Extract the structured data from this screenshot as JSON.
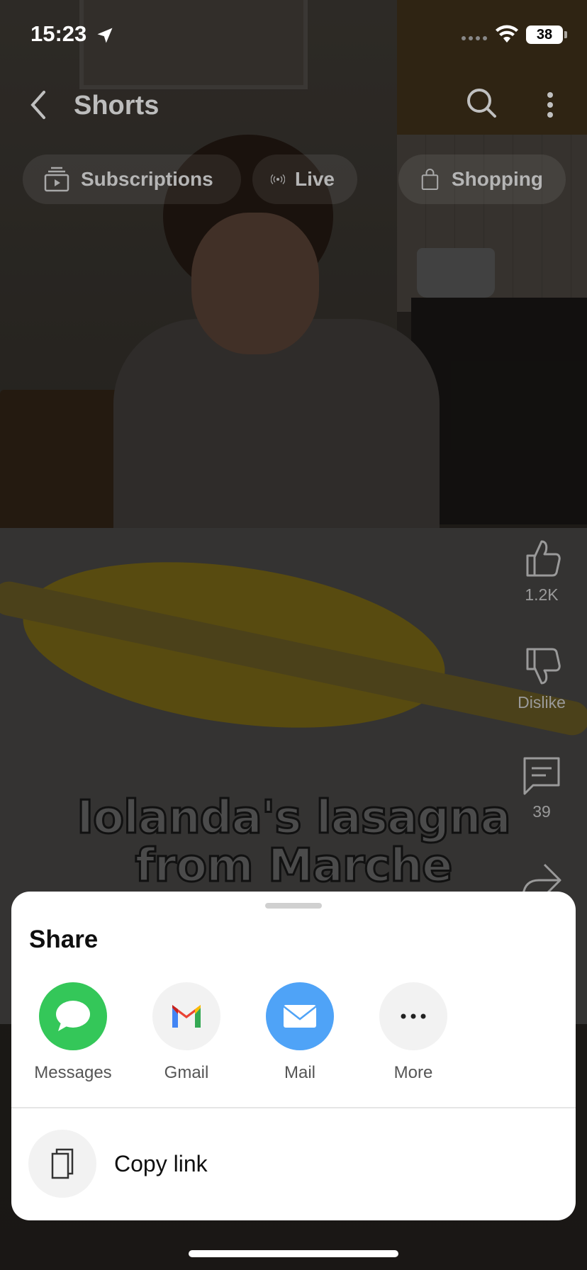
{
  "status_bar": {
    "time": "15:23",
    "battery": "38",
    "icons": [
      "location-arrow-icon",
      "cellular-signal-icon",
      "wifi-icon",
      "battery-icon"
    ]
  },
  "app_bar": {
    "title": "Shorts",
    "icons": [
      "back-icon",
      "search-icon",
      "more-vertical-icon"
    ]
  },
  "chips": [
    {
      "label": "Subscriptions",
      "icon": "subscriptions-icon"
    },
    {
      "label": "Live",
      "icon": "live-icon"
    },
    {
      "label": "Shopping",
      "icon": "shopping-bag-icon"
    }
  ],
  "video": {
    "caption_line1": "Iolanda's lasagna",
    "caption_line2": "from Marche"
  },
  "actions": {
    "like_count": "1.2K",
    "dislike_label": "Dislike",
    "comment_count": "39"
  },
  "share_sheet": {
    "title": "Share",
    "targets": [
      {
        "label": "Messages",
        "icon": "messages-icon",
        "color": "#34c759"
      },
      {
        "label": "Gmail",
        "icon": "gmail-icon",
        "color": "#f2f2f2"
      },
      {
        "label": "Mail",
        "icon": "mail-icon",
        "color": "#4fa3f7"
      },
      {
        "label": "More",
        "icon": "more-horizontal-icon",
        "color": "#f2f2f2"
      }
    ],
    "copy_link_label": "Copy link"
  }
}
